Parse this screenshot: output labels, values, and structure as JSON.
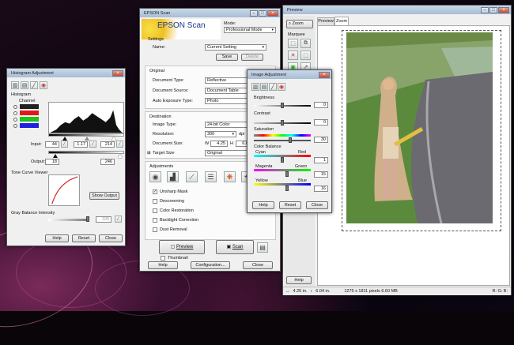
{
  "histogram": {
    "title": "Histogram Adjustment",
    "histogram_label": "Histogram",
    "channel_label": "Channel",
    "input_label": "Input:",
    "input_shadow": "44",
    "input_gamma": "1.17",
    "input_highlight": "214",
    "output_label": "Output:",
    "output_low": "18",
    "output_high": "246",
    "tone_curve_label": "Tone Curve Viewer",
    "show_output_label": "Show Output",
    "gray_balance_label": "Gray Balance Intensity",
    "gray_balance_value": "100",
    "help": "Help",
    "reset": "Reset",
    "close": "Close"
  },
  "epson": {
    "title": "EPSON Scan",
    "brand": "EPSON Scan",
    "mode_label": "Mode:",
    "mode_value": "Professional Mode",
    "settings_label": "Settings",
    "name_label": "Name:",
    "name_value": "Current Setting",
    "save": "Save",
    "delete": "Delete",
    "original_label": "Original",
    "doc_type_label": "Document Type:",
    "doc_type_value": "Reflective",
    "doc_source_label": "Document Source:",
    "doc_source_value": "Document Table",
    "auto_exposure_label": "Auto Exposure Type:",
    "auto_exposure_value": "Photo",
    "destination_label": "Destination",
    "image_type_label": "Image Type:",
    "image_type_value": "24-bit Color",
    "resolution_label": "Resolution:",
    "resolution_value": "300",
    "resolution_unit": "dpi",
    "doc_size_label": "Document Size:",
    "doc_w_label": "W",
    "doc_w": "4.25",
    "doc_h_label": "H",
    "doc_h": "6.04",
    "target_size_label": "Target Size",
    "target_size_value": "Original",
    "adjustments_label": "Adjustments",
    "checks": [
      "Unsharp Mask",
      "Descreening",
      "Color Restoration",
      "Backlight Correction",
      "Dust Removal"
    ],
    "preview": "Preview",
    "thumbnail": "Thumbnail",
    "scan": "Scan",
    "help": "Help",
    "configuration": "Configuration...",
    "close": "Close"
  },
  "image_adj": {
    "title": "Image Adjustment",
    "brightness_label": "Brightness",
    "brightness_value": "0",
    "contrast_label": "Contrast",
    "contrast_value": "0",
    "saturation_label": "Saturation",
    "saturation_value": "30",
    "color_balance_label": "Color Balance",
    "cyan_label": "Cyan",
    "red_label": "Red",
    "cyan_red_value": "1",
    "magenta_label": "Magenta",
    "green_label": "Green",
    "magenta_green_value": "15",
    "yellow_label": "Yellow",
    "blue_label": "Blue",
    "yellow_blue_value": "16",
    "help": "Help",
    "reset": "Reset",
    "close": "Close"
  },
  "preview": {
    "title": "Preview",
    "tab_preview": "Preview",
    "tab_zoom": "Zoom",
    "zoom_btn": "Zoom",
    "marquee_label": "Marquee",
    "help": "Help",
    "size_w": "4.25 in.",
    "size_h": "6.04 in.",
    "pixels": "1275 x 1811 pixels 6.60 MB",
    "rgb": "R: G: B:"
  }
}
